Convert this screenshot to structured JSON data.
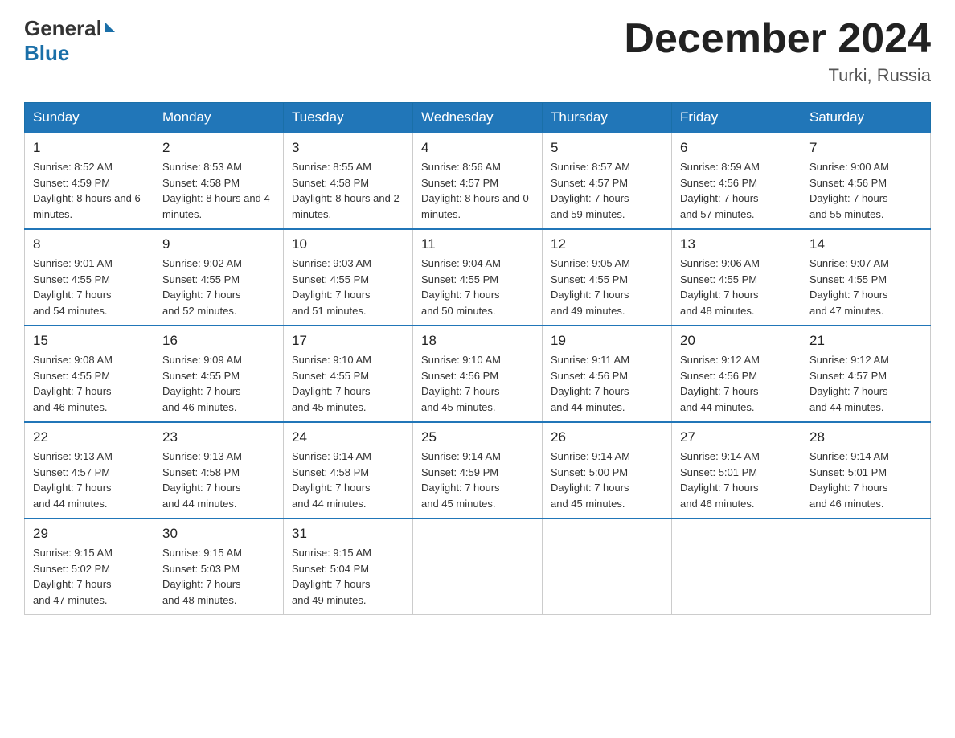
{
  "header": {
    "logo_general": "General",
    "logo_blue": "Blue",
    "month_title": "December 2024",
    "location": "Turki, Russia"
  },
  "calendar": {
    "days_of_week": [
      "Sunday",
      "Monday",
      "Tuesday",
      "Wednesday",
      "Thursday",
      "Friday",
      "Saturday"
    ],
    "weeks": [
      [
        {
          "day": "1",
          "sunrise": "8:52 AM",
          "sunset": "4:59 PM",
          "daylight": "8 hours and 6 minutes."
        },
        {
          "day": "2",
          "sunrise": "8:53 AM",
          "sunset": "4:58 PM",
          "daylight": "8 hours and 4 minutes."
        },
        {
          "day": "3",
          "sunrise": "8:55 AM",
          "sunset": "4:58 PM",
          "daylight": "8 hours and 2 minutes."
        },
        {
          "day": "4",
          "sunrise": "8:56 AM",
          "sunset": "4:57 PM",
          "daylight": "8 hours and 0 minutes."
        },
        {
          "day": "5",
          "sunrise": "8:57 AM",
          "sunset": "4:57 PM",
          "daylight": "7 hours and 59 minutes."
        },
        {
          "day": "6",
          "sunrise": "8:59 AM",
          "sunset": "4:56 PM",
          "daylight": "7 hours and 57 minutes."
        },
        {
          "day": "7",
          "sunrise": "9:00 AM",
          "sunset": "4:56 PM",
          "daylight": "7 hours and 55 minutes."
        }
      ],
      [
        {
          "day": "8",
          "sunrise": "9:01 AM",
          "sunset": "4:55 PM",
          "daylight": "7 hours and 54 minutes."
        },
        {
          "day": "9",
          "sunrise": "9:02 AM",
          "sunset": "4:55 PM",
          "daylight": "7 hours and 52 minutes."
        },
        {
          "day": "10",
          "sunrise": "9:03 AM",
          "sunset": "4:55 PM",
          "daylight": "7 hours and 51 minutes."
        },
        {
          "day": "11",
          "sunrise": "9:04 AM",
          "sunset": "4:55 PM",
          "daylight": "7 hours and 50 minutes."
        },
        {
          "day": "12",
          "sunrise": "9:05 AM",
          "sunset": "4:55 PM",
          "daylight": "7 hours and 49 minutes."
        },
        {
          "day": "13",
          "sunrise": "9:06 AM",
          "sunset": "4:55 PM",
          "daylight": "7 hours and 48 minutes."
        },
        {
          "day": "14",
          "sunrise": "9:07 AM",
          "sunset": "4:55 PM",
          "daylight": "7 hours and 47 minutes."
        }
      ],
      [
        {
          "day": "15",
          "sunrise": "9:08 AM",
          "sunset": "4:55 PM",
          "daylight": "7 hours and 46 minutes."
        },
        {
          "day": "16",
          "sunrise": "9:09 AM",
          "sunset": "4:55 PM",
          "daylight": "7 hours and 46 minutes."
        },
        {
          "day": "17",
          "sunrise": "9:10 AM",
          "sunset": "4:55 PM",
          "daylight": "7 hours and 45 minutes."
        },
        {
          "day": "18",
          "sunrise": "9:10 AM",
          "sunset": "4:56 PM",
          "daylight": "7 hours and 45 minutes."
        },
        {
          "day": "19",
          "sunrise": "9:11 AM",
          "sunset": "4:56 PM",
          "daylight": "7 hours and 44 minutes."
        },
        {
          "day": "20",
          "sunrise": "9:12 AM",
          "sunset": "4:56 PM",
          "daylight": "7 hours and 44 minutes."
        },
        {
          "day": "21",
          "sunrise": "9:12 AM",
          "sunset": "4:57 PM",
          "daylight": "7 hours and 44 minutes."
        }
      ],
      [
        {
          "day": "22",
          "sunrise": "9:13 AM",
          "sunset": "4:57 PM",
          "daylight": "7 hours and 44 minutes."
        },
        {
          "day": "23",
          "sunrise": "9:13 AM",
          "sunset": "4:58 PM",
          "daylight": "7 hours and 44 minutes."
        },
        {
          "day": "24",
          "sunrise": "9:14 AM",
          "sunset": "4:58 PM",
          "daylight": "7 hours and 44 minutes."
        },
        {
          "day": "25",
          "sunrise": "9:14 AM",
          "sunset": "4:59 PM",
          "daylight": "7 hours and 45 minutes."
        },
        {
          "day": "26",
          "sunrise": "9:14 AM",
          "sunset": "5:00 PM",
          "daylight": "7 hours and 45 minutes."
        },
        {
          "day": "27",
          "sunrise": "9:14 AM",
          "sunset": "5:01 PM",
          "daylight": "7 hours and 46 minutes."
        },
        {
          "day": "28",
          "sunrise": "9:14 AM",
          "sunset": "5:01 PM",
          "daylight": "7 hours and 46 minutes."
        }
      ],
      [
        {
          "day": "29",
          "sunrise": "9:15 AM",
          "sunset": "5:02 PM",
          "daylight": "7 hours and 47 minutes."
        },
        {
          "day": "30",
          "sunrise": "9:15 AM",
          "sunset": "5:03 PM",
          "daylight": "7 hours and 48 minutes."
        },
        {
          "day": "31",
          "sunrise": "9:15 AM",
          "sunset": "5:04 PM",
          "daylight": "7 hours and 49 minutes."
        },
        null,
        null,
        null,
        null
      ]
    ],
    "sunrise_label": "Sunrise:",
    "sunset_label": "Sunset:",
    "daylight_label": "Daylight:"
  }
}
